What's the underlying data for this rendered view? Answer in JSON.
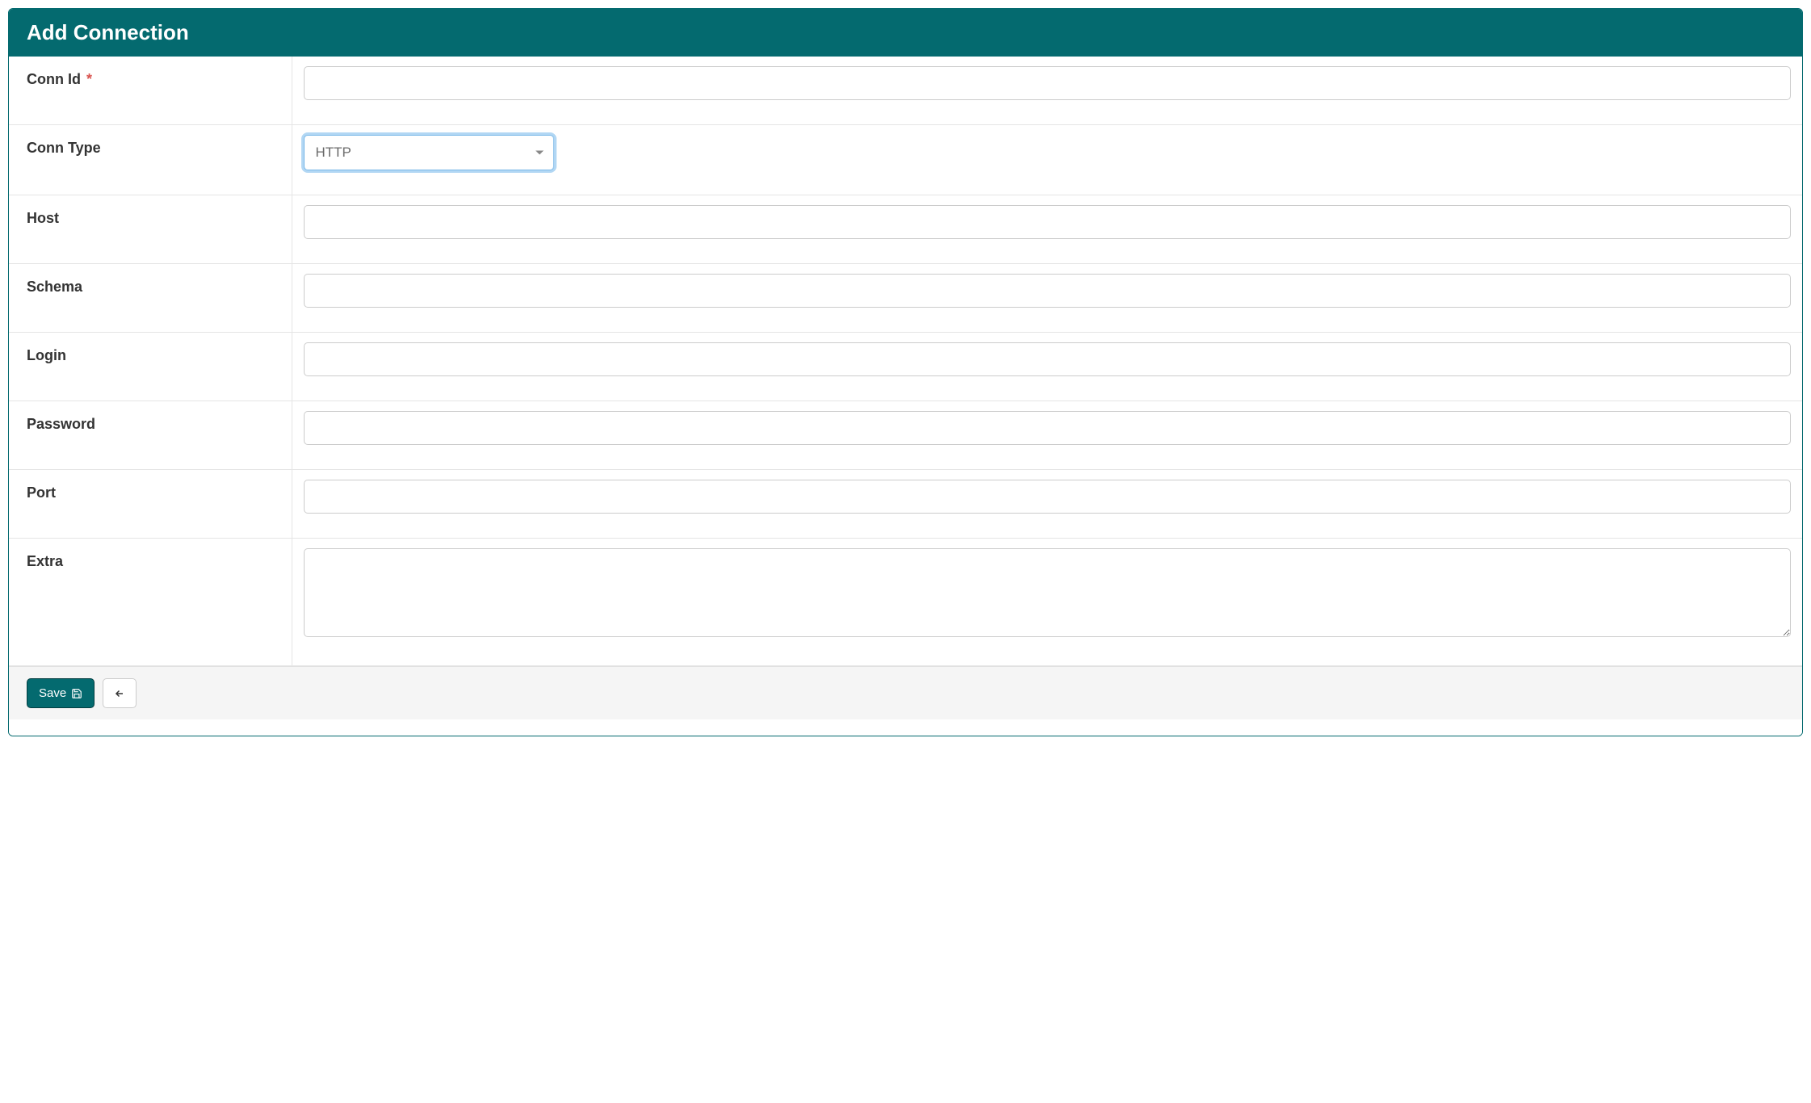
{
  "header": {
    "title": "Add Connection"
  },
  "fields": {
    "conn_id": {
      "label": "Conn Id",
      "required": true,
      "value": ""
    },
    "conn_type": {
      "label": "Conn Type",
      "selected": "HTTP"
    },
    "host": {
      "label": "Host",
      "value": ""
    },
    "schema": {
      "label": "Schema",
      "value": ""
    },
    "login": {
      "label": "Login",
      "value": ""
    },
    "password": {
      "label": "Password",
      "value": ""
    },
    "port": {
      "label": "Port",
      "value": ""
    },
    "extra": {
      "label": "Extra",
      "value": ""
    }
  },
  "footer": {
    "save_label": "Save"
  },
  "required_marker": "*"
}
